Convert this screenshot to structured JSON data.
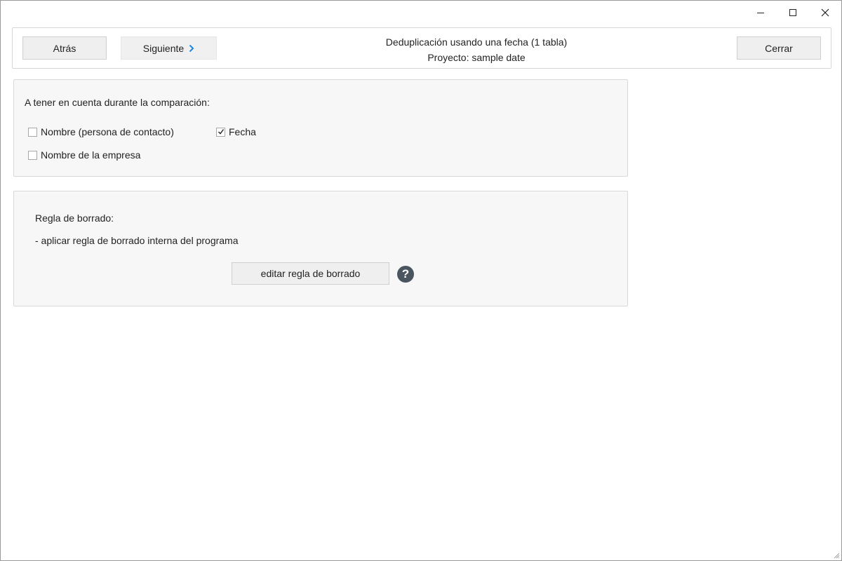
{
  "window": {
    "controls": {
      "minimize": "minimize-icon",
      "maximize": "maximize-icon",
      "close": "close-icon"
    }
  },
  "toolbar": {
    "back_label": "Atrás",
    "next_label": "Siguiente",
    "close_label": "Cerrar",
    "title_line1": "Deduplicación usando una fecha (1 tabla)",
    "title_line2": "Proyecto: sample date",
    "accent_color": "#1e88e5"
  },
  "compare": {
    "heading": "A tener en cuenta durante la comparación:",
    "options": [
      {
        "label": "Nombre (persona de contacto)",
        "checked": false
      },
      {
        "label": "Fecha",
        "checked": true
      },
      {
        "label": "Nombre de la empresa",
        "checked": false
      }
    ]
  },
  "rule": {
    "title": "Regla de borrado:",
    "description": "- aplicar regla de borrado interna del programa",
    "edit_label": "editar regla de borrado",
    "help_glyph": "?",
    "help_icon": "help-icon"
  }
}
